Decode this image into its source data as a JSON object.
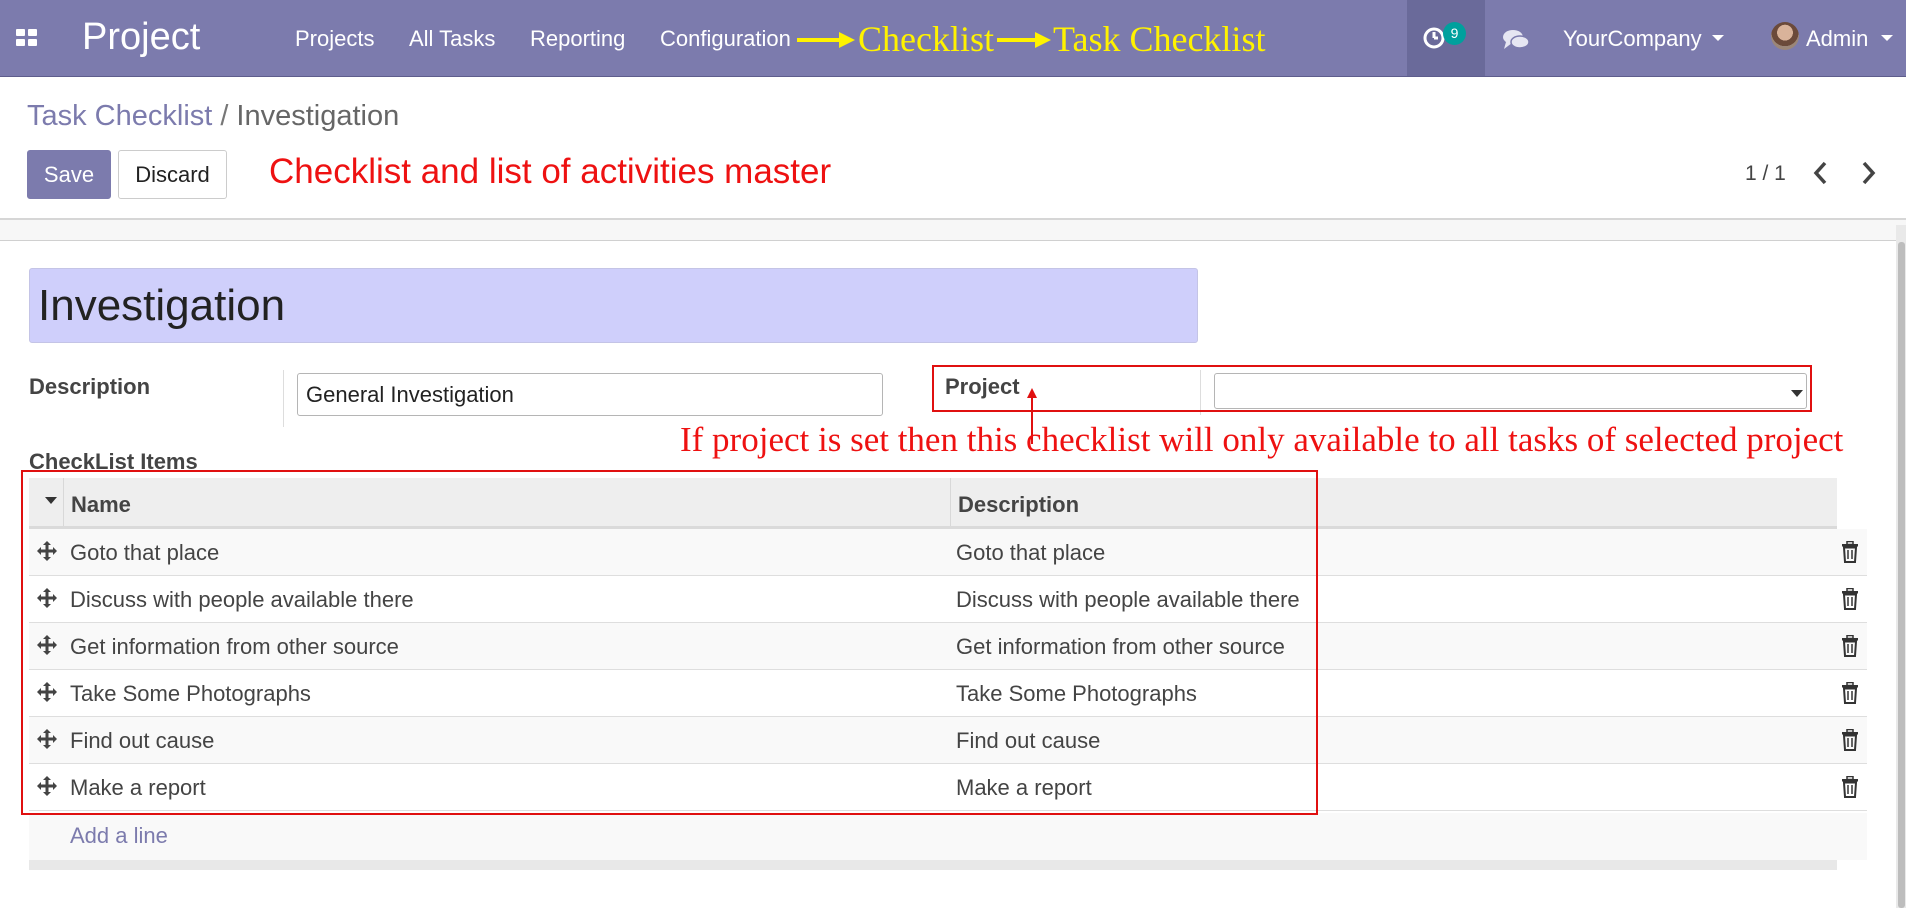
{
  "navbar": {
    "app_title": "Project",
    "menu": [
      "Projects",
      "All Tasks",
      "Reporting",
      "Configuration"
    ],
    "annotation_path": [
      "Checklist",
      "Task Checklist"
    ],
    "activity_count": "9",
    "company": "YourCompany",
    "user": "Admin",
    "colors": {
      "bar": "#7c7bad",
      "annotation": "#fff200",
      "badge": "#00a09d"
    }
  },
  "control": {
    "breadcrumb_parent": "Task Checklist",
    "breadcrumb_separator": "/",
    "breadcrumb_current": "Investigation",
    "save_label": "Save",
    "discard_label": "Discard",
    "pager": "1 / 1"
  },
  "annotations": {
    "top_note": "Checklist and list of activities  master",
    "project_note": "If project is set then this checklist will only available to all tasks of selected project",
    "color": "#ee1111"
  },
  "form": {
    "name": "Investigation",
    "description_label": "Description",
    "description_value": "General Investigation",
    "project_label": "Project",
    "project_value": "",
    "checklist_label": "CheckList Items"
  },
  "checklist": {
    "columns": [
      "Name",
      "Description"
    ],
    "rows": [
      {
        "name": "Goto that place",
        "description": "Goto that place"
      },
      {
        "name": "Discuss with people available there",
        "description": "Discuss with people available there"
      },
      {
        "name": "Get information from other source",
        "description": "Get information from other source"
      },
      {
        "name": "Take Some Photographs",
        "description": "Take Some Photographs"
      },
      {
        "name": "Find out cause",
        "description": "Find out cause"
      },
      {
        "name": "Make a report",
        "description": "Make a report"
      }
    ],
    "add_line": "Add a line"
  }
}
